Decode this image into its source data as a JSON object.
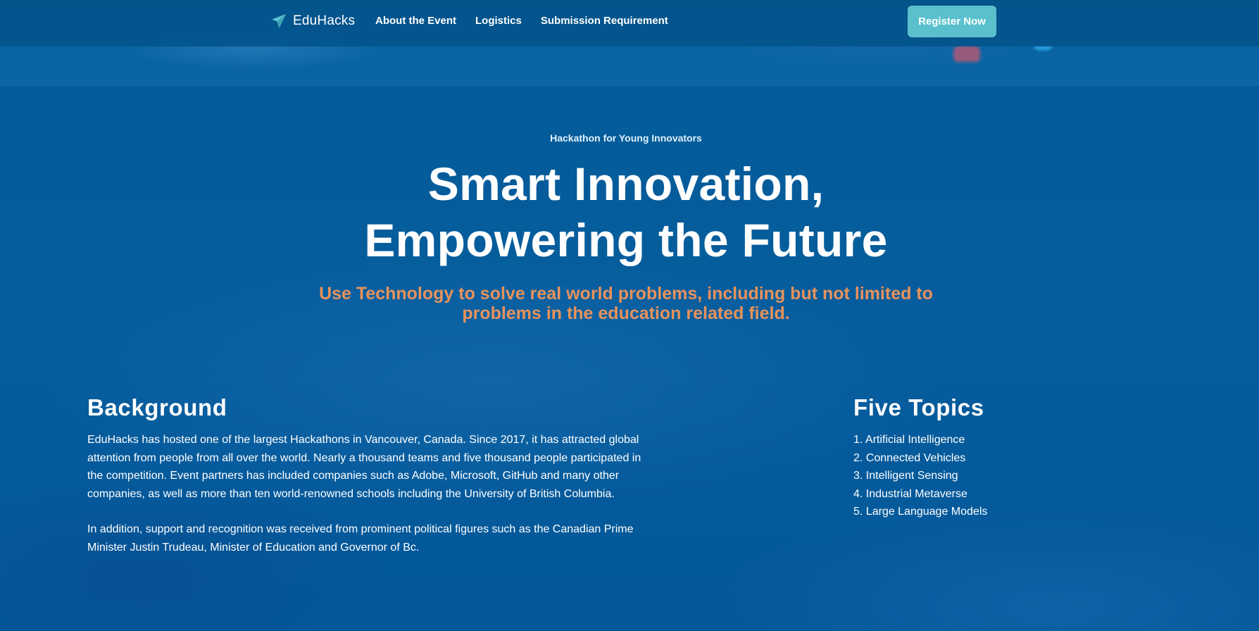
{
  "nav": {
    "brand": "EduHacks",
    "brand_icon": "paper-plane-icon",
    "links": [
      "About the Event",
      "Logistics",
      "Submission Requirement"
    ],
    "register_label": "Register Now"
  },
  "hero": {
    "eyebrow": "Hackathon for Young Innovators",
    "title_line1": "Smart Innovation,",
    "title_line2": "Empowering the Future",
    "subtitle": "Use Technology to solve real world problems, including but not limited to problems in the education related field."
  },
  "background": {
    "heading": "Background",
    "paragraphs": [
      "EduHacks has hosted one of the largest Hackathons in Vancouver, Canada. Since 2017, it has attracted global attention from people from all over the world. Nearly a thousand teams and five thousand people participated in the competition. Event partners has included companies such as Adobe, Microsoft, GitHub and many other companies, as well as more than ten world-renowned schools including the University of British Columbia.",
      "In addition, support and recognition was received from prominent political figures such as the Canadian Prime Minister Justin Trudeau, Minister of Education and Governor of Bc."
    ]
  },
  "topics": {
    "heading": "Five Topics",
    "items": [
      "1. Artificial Intelligence",
      "2. Connected Vehicles",
      "3. Intelligent Sensing",
      "4. Industrial Metaverse",
      "5. Large Language Models"
    ]
  },
  "colors": {
    "background": "#065d9c",
    "nav_background": "#04548c",
    "accent_button": "#5bc0cd",
    "subtitle": "#e8925c",
    "brand_icon": "#5ec3cf"
  }
}
